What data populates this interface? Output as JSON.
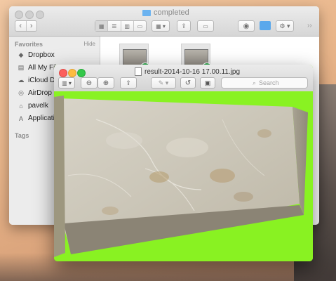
{
  "finder": {
    "title": "completed",
    "sidebar": {
      "favorites_heading": "Favorites",
      "hide_label": "Hide",
      "items": [
        {
          "label": "Dropbox",
          "icon": "dropbox-icon"
        },
        {
          "label": "All My Files",
          "icon": "all-files-icon"
        },
        {
          "label": "iCloud D",
          "icon": "cloud-icon"
        },
        {
          "label": "AirDrop",
          "icon": "airdrop-icon"
        },
        {
          "label": "pavelk",
          "icon": "home-icon"
        },
        {
          "label": "Applicati",
          "icon": "applications-icon"
        }
      ],
      "tags_heading": "Tags"
    },
    "nav": {
      "back": "‹",
      "forward": "›"
    },
    "more": "››"
  },
  "preview": {
    "title": "result-2014-10-16 17.00.11.jpg",
    "search_placeholder": "Search"
  },
  "colors": {
    "preview_background": "#89f222",
    "badge": "#2aa84a",
    "folder": "#6cb3f0"
  }
}
